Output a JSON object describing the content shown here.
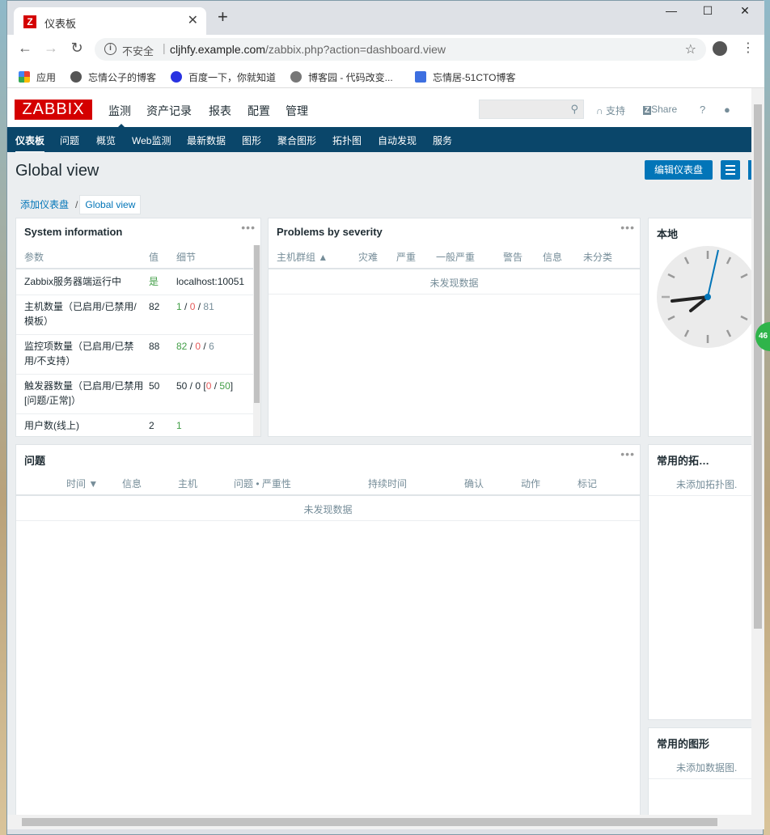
{
  "tab": {
    "title": "仪表板",
    "favicon_letter": "Z"
  },
  "window_controls": {
    "minimize": "—",
    "maximize": "☐",
    "close": "✕"
  },
  "address": {
    "security": "不安全",
    "host": "cljhfy.example.com",
    "path": "/zabbix.php?action=dashboard.view"
  },
  "bookmarks": [
    {
      "label": "应用",
      "icon": "apps-icon"
    },
    {
      "label": "忘情公子的博客",
      "icon": "globe-icon"
    },
    {
      "label": "百度一下，你就知道",
      "icon": "baidu-paw-icon"
    },
    {
      "label": "博客园 - 代码改变...",
      "icon": "cnblogs-icon"
    },
    {
      "label": "忘情居-51CTO博客",
      "icon": "feather-icon"
    }
  ],
  "zabbix": {
    "logo": "ZABBIX",
    "top_nav": [
      "监测",
      "资产记录",
      "报表",
      "配置",
      "管理"
    ],
    "links": {
      "support": "支持",
      "share": "Share",
      "help": "?"
    },
    "sub_nav": [
      "仪表板",
      "问题",
      "概览",
      "Web监测",
      "最新数据",
      "图形",
      "聚合图形",
      "拓扑图",
      "自动发现",
      "服务"
    ]
  },
  "page": {
    "title": "Global view",
    "edit_button": "编辑仪表盘",
    "breadcrumbs": [
      "添加仪表盘",
      "Global view"
    ]
  },
  "widgets": {
    "sysinfo": {
      "title": "System information",
      "headers": [
        "参数",
        "值",
        "细节"
      ],
      "rows": [
        {
          "param": "Zabbix服务器端运行中",
          "value": "是",
          "detail": "localhost:10051"
        },
        {
          "param": "主机数量（已启用/已禁用/模板）",
          "value": "82",
          "d1": "1",
          "d2": "0",
          "d3": "81"
        },
        {
          "param": "监控项数量（已启用/已禁用/不支持）",
          "value": "88",
          "d1": "82",
          "d2": "0",
          "d3": "6"
        },
        {
          "param": "触发器数量（已启用/已禁用 [问题/正常]）",
          "value": "50",
          "d1": "50 / 0 [",
          "d2": "0",
          "d3": "50",
          "d4": "]"
        },
        {
          "param": "用户数(线上)",
          "value": "2",
          "detail": "1"
        }
      ]
    },
    "problems_severity": {
      "title": "Problems by severity",
      "headers": [
        "主机群组 ▲",
        "灾难",
        "严重",
        "一般严重",
        "警告",
        "信息",
        "未分类"
      ],
      "empty": "未发现数据"
    },
    "clock": {
      "title": "本地"
    },
    "problems": {
      "title": "问题",
      "headers": [
        "时间 ▼",
        "信息",
        "主机",
        "问题 • 严重性",
        "持续时间",
        "确认",
        "动作",
        "标记"
      ],
      "empty": "未发现数据"
    },
    "fav_maps": {
      "title": "常用的拓…",
      "empty": "未添加拓扑图."
    },
    "fav_graphs": {
      "title": "常用的图形",
      "empty": "未添加数据图."
    }
  },
  "side_badge": "46"
}
